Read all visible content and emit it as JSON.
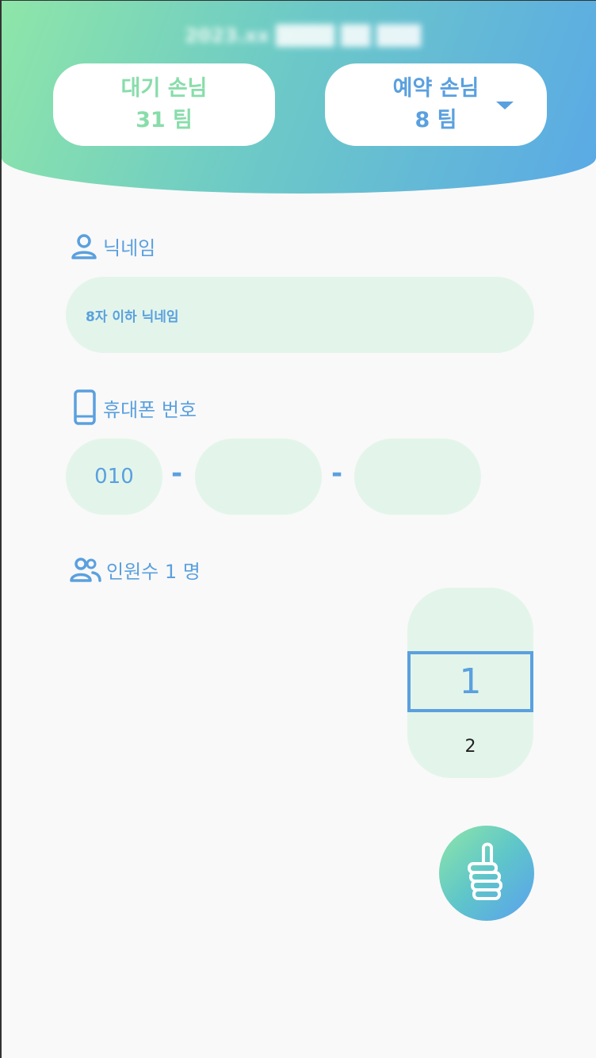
{
  "header": {
    "title": "2023.xx ████ ██ ███",
    "waiting": {
      "label": "대기 손님",
      "count": "31 팀"
    },
    "reserved": {
      "label": "예약 손님",
      "count": "8 팀"
    }
  },
  "form": {
    "nickname": {
      "label": "닉네임",
      "placeholder": "8자 이하 닉네임"
    },
    "phone": {
      "label": "휴대폰 번호",
      "part1": "010",
      "part2": "",
      "part3": "",
      "separator": "-"
    },
    "party": {
      "label": "인원수 1 명",
      "selected": "1",
      "next": "2"
    }
  },
  "icons": {
    "nickname": "person-icon",
    "phone": "phone-icon",
    "party": "people-icon",
    "submit": "thumbs-up-icon",
    "dropdown": "triangle-down-icon"
  },
  "colors": {
    "accent_green": "#88ddaa",
    "accent_blue": "#5aa0df",
    "input_bg": "#e3f5ea"
  }
}
